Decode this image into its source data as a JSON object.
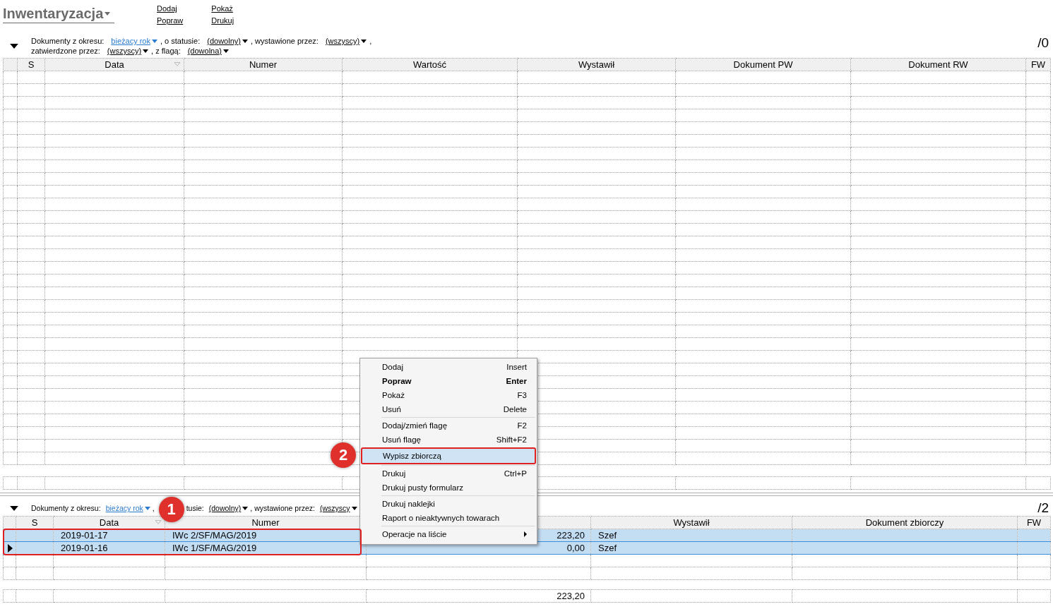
{
  "header": {
    "title": "Inwentaryzacja",
    "actions": [
      [
        "Dodaj",
        "Popraw"
      ],
      [
        "Pokaż",
        "Drukuj"
      ]
    ]
  },
  "upper": {
    "filter_lines": [
      [
        {
          "kind": "label",
          "text": "Dokumenty z okresu:"
        },
        {
          "kind": "link",
          "text": "bieżacy rok"
        },
        {
          "kind": "label",
          "text": ", o statusie:"
        },
        {
          "kind": "dropdown",
          "text": "(dowolny)"
        },
        {
          "kind": "label",
          "text": ", wystawione przez:"
        },
        {
          "kind": "dropdown",
          "text": "(wszyscy)"
        },
        {
          "kind": "label",
          "text": ","
        }
      ],
      [
        {
          "kind": "label",
          "text": "zatwierdzone przez:"
        },
        {
          "kind": "dropdown",
          "text": "(wszyscy)"
        },
        {
          "kind": "label",
          "text": ", z flagą:"
        },
        {
          "kind": "dropdown",
          "text": "(dowolna)"
        }
      ]
    ],
    "count": "/0",
    "table": {
      "columns": [
        {
          "label": "S"
        },
        {
          "label": "Data"
        },
        {
          "label": "Numer"
        },
        {
          "label": "Wartość"
        },
        {
          "label": "Wystawił"
        },
        {
          "label": "Dokument PW"
        },
        {
          "label": "Dokument RW"
        },
        {
          "label": "FW"
        }
      ]
    }
  },
  "lower": {
    "filter_lines": [
      [
        {
          "kind": "label",
          "text": "Dokumenty z okresu:"
        },
        {
          "kind": "link",
          "text": "bieżacy rok"
        },
        {
          "kind": "label",
          "text": ","
        },
        {
          "kind": "covered"
        },
        {
          "kind": "label",
          "text": "tusie:"
        },
        {
          "kind": "dropdown",
          "text": "(dowolny)"
        },
        {
          "kind": "label",
          "text": ", wystawione przez:"
        },
        {
          "kind": "dropdown",
          "text": "(wszyscy"
        }
      ]
    ],
    "count": "/2",
    "table": {
      "columns": [
        {
          "label": "S"
        },
        {
          "label": "Data"
        },
        {
          "label": "Numer"
        },
        {},
        {
          "label": "Wystawił"
        },
        {
          "label": "Dokument zbiorczy"
        },
        {
          "label": "FW"
        }
      ],
      "rows": [
        {
          "selected": true,
          "current": false,
          "cells": [
            "",
            "2019-01-17",
            "IWc 2/SF/MAG/2019",
            "223,20",
            "Szef",
            "",
            ""
          ]
        },
        {
          "selected": true,
          "current": true,
          "cells": [
            "",
            "2019-01-16",
            "IWc 1/SF/MAG/2019",
            "0,00",
            "Szef",
            "",
            ""
          ]
        }
      ],
      "footer": {
        "cells": [
          "",
          "",
          "",
          "223,20",
          "",
          "",
          ""
        ]
      }
    }
  },
  "context_menu": {
    "groups": [
      [
        {
          "label": "Dodaj",
          "shortcut": "Insert",
          "default": false,
          "selected": false,
          "submenu": false
        },
        {
          "label": "Popraw",
          "shortcut": "Enter",
          "default": true,
          "selected": false,
          "submenu": false
        },
        {
          "label": "Pokaż",
          "shortcut": "F3",
          "default": false,
          "selected": false,
          "submenu": false
        },
        {
          "label": "Usuń",
          "shortcut": "Delete",
          "default": false,
          "selected": false,
          "submenu": false
        }
      ],
      [
        {
          "label": "Dodaj/zmień flagę",
          "shortcut": "F2",
          "default": false,
          "selected": false,
          "submenu": false
        },
        {
          "label": "Usuń flagę",
          "shortcut": "Shift+F2",
          "default": false,
          "selected": false,
          "submenu": false
        },
        {
          "label": "Wypisz zbiorczą",
          "default": false,
          "selected": true,
          "submenu": false
        }
      ],
      [
        {
          "label": "Drukuj",
          "shortcut": "Ctrl+P",
          "default": false,
          "selected": false,
          "submenu": false
        },
        {
          "label": "Drukuj pusty formularz",
          "default": false,
          "selected": false,
          "submenu": false
        }
      ],
      [
        {
          "label": "Drukuj naklejki",
          "default": false,
          "selected": false,
          "submenu": false
        },
        {
          "label": "Raport o nieaktywnych towarach",
          "default": false,
          "selected": false,
          "submenu": false
        }
      ],
      [
        {
          "label": "Operacje na liście",
          "default": false,
          "selected": false,
          "submenu": true
        }
      ]
    ]
  },
  "annotations": [
    {
      "kind": "rows",
      "label": "1"
    },
    {
      "kind": "menu",
      "label": "2"
    }
  ]
}
